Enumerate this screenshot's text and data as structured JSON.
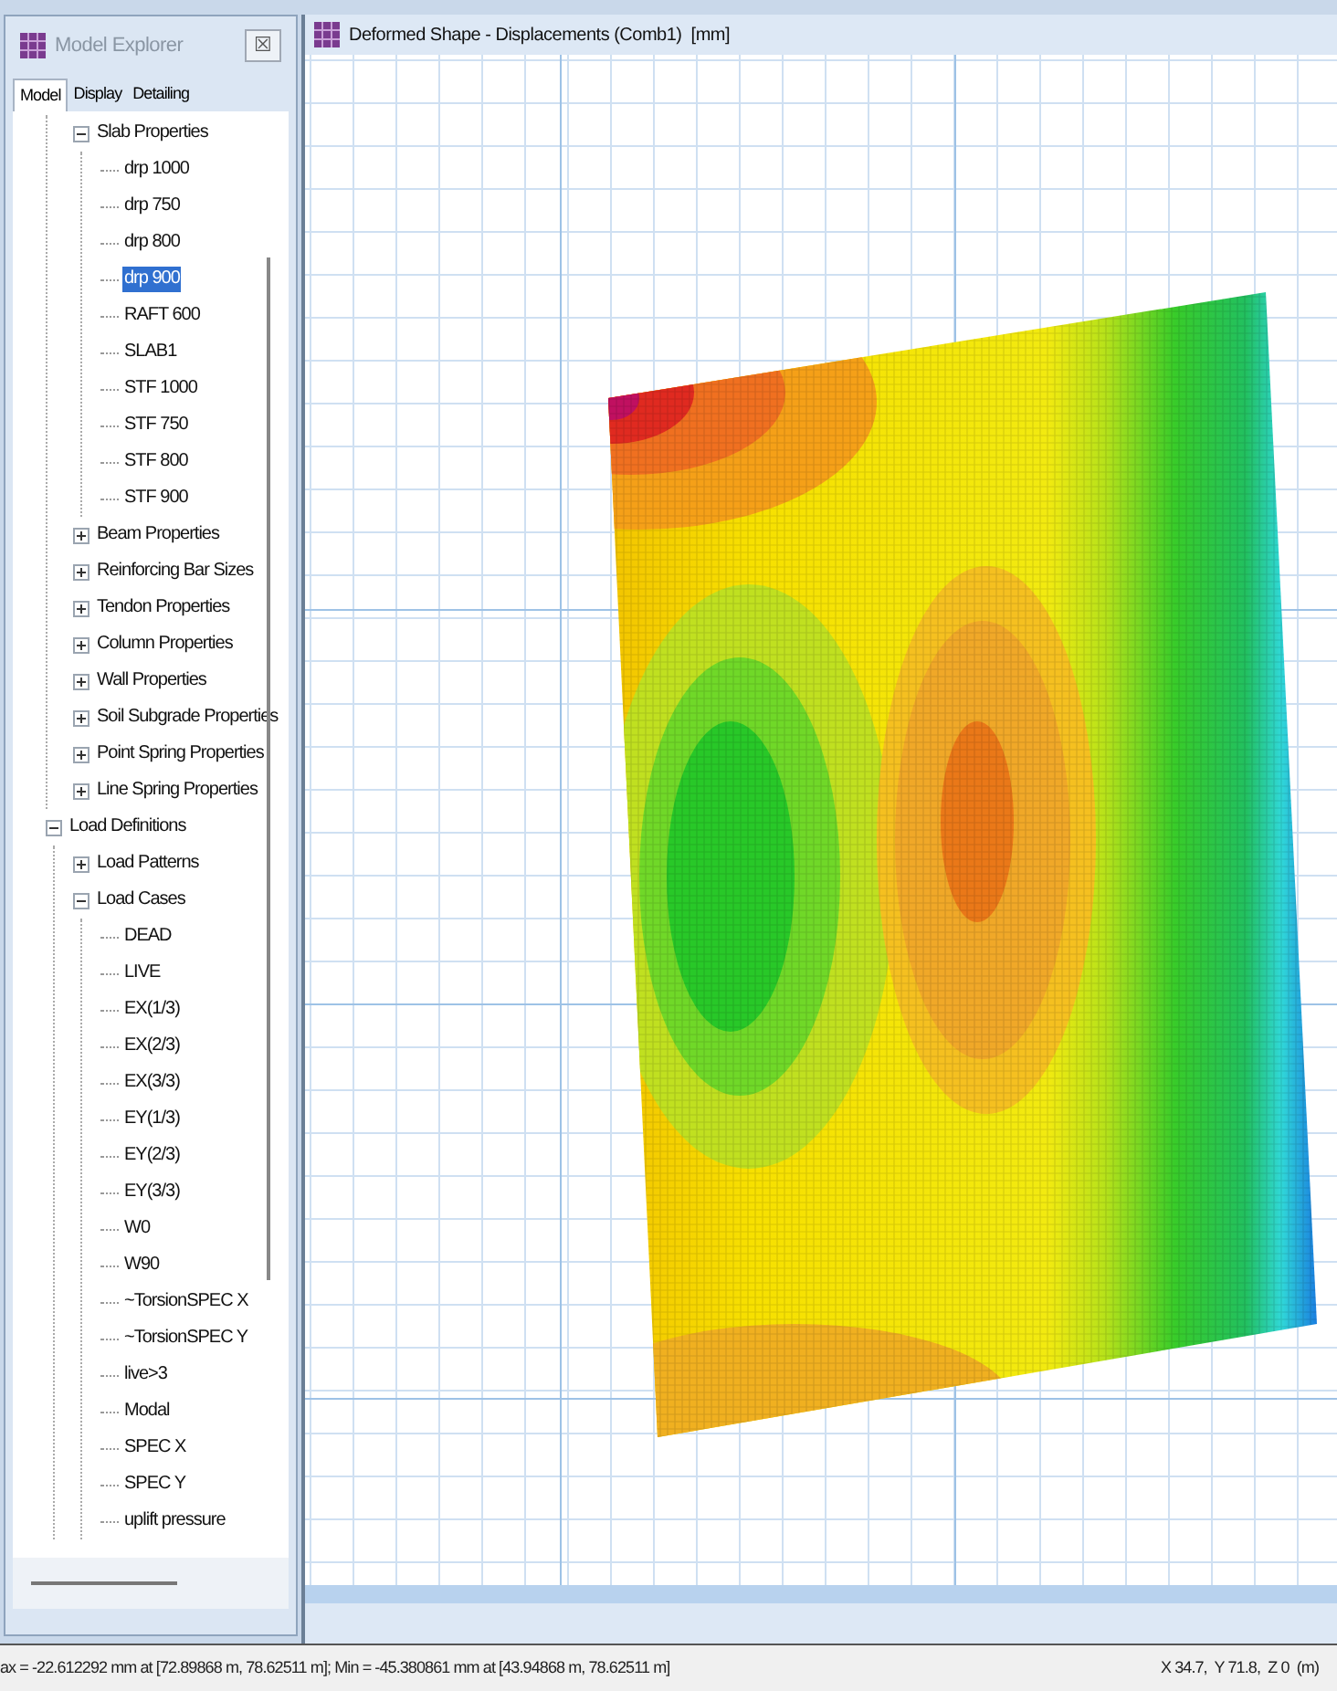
{
  "explorer": {
    "title": "Model Explorer",
    "close": "☒",
    "tabs": [
      {
        "label": "Model",
        "selected": true
      },
      {
        "label": "Display",
        "selected": false
      },
      {
        "label": "Detailing",
        "selected": false
      }
    ],
    "tree": [
      {
        "children": [
          {
            "label": "Slab Properties",
            "expanded": true,
            "children": [
              {
                "label": "drp 1000",
                "selected": false
              },
              {
                "label": "drp 750",
                "selected": false
              },
              {
                "label": "drp 800",
                "selected": false
              },
              {
                "label": "drp 900",
                "selected": true
              },
              {
                "label": "RAFT 600",
                "selected": false
              },
              {
                "label": "SLAB1",
                "selected": false
              },
              {
                "label": "STF 1000",
                "selected": false
              },
              {
                "label": "STF 750",
                "selected": false
              },
              {
                "label": "STF 800",
                "selected": false
              },
              {
                "label": "STF 900",
                "selected": false
              }
            ]
          },
          {
            "label": "Beam Properties",
            "expanded": false
          },
          {
            "label": "Reinforcing Bar Sizes",
            "expanded": false
          },
          {
            "label": "Tendon Properties",
            "expanded": false
          },
          {
            "label": "Column Properties",
            "expanded": false
          },
          {
            "label": "Wall Properties",
            "expanded": false
          },
          {
            "label": "Soil Subgrade Properties",
            "expanded": false
          },
          {
            "label": "Point Spring Properties",
            "expanded": false
          },
          {
            "label": "Line Spring Properties",
            "expanded": false
          }
        ]
      },
      {
        "label": "Load Definitions",
        "expanded": true,
        "children": [
          {
            "label": "Load Patterns",
            "expanded": false
          },
          {
            "label": "Load Cases",
            "expanded": true,
            "children": [
              {
                "label": "DEAD",
                "selected": false
              },
              {
                "label": "LIVE",
                "selected": false
              },
              {
                "label": "EX(1/3)",
                "selected": false
              },
              {
                "label": "EX(2/3)",
                "selected": false
              },
              {
                "label": "EX(3/3)",
                "selected": false
              },
              {
                "label": "EY(1/3)",
                "selected": false
              },
              {
                "label": "EY(2/3)",
                "selected": false
              },
              {
                "label": "EY(3/3)",
                "selected": false
              },
              {
                "label": "W0",
                "selected": false
              },
              {
                "label": "W90",
                "selected": false
              },
              {
                "label": "~TorsionSPEC X",
                "selected": false
              },
              {
                "label": "~TorsionSPEC Y",
                "selected": false
              },
              {
                "label": "live>3",
                "selected": false
              },
              {
                "label": "Modal",
                "selected": false
              },
              {
                "label": "SPEC X",
                "selected": false
              },
              {
                "label": "SPEC Y",
                "selected": false
              },
              {
                "label": "uplift pressure",
                "selected": false
              }
            ]
          }
        ]
      }
    ]
  },
  "view": {
    "title": "Deformed Shape - Displacements (Comb1)  [mm]"
  },
  "status_bar": {
    "left": "ax = -22.612292 mm at [72.89868 m, 78.62511 m];  Min = -45.380861 mm at [43.94868 m, 78.62511 m]",
    "right": "X 34.7,  Y 71.8,  Z 0  (m)"
  }
}
